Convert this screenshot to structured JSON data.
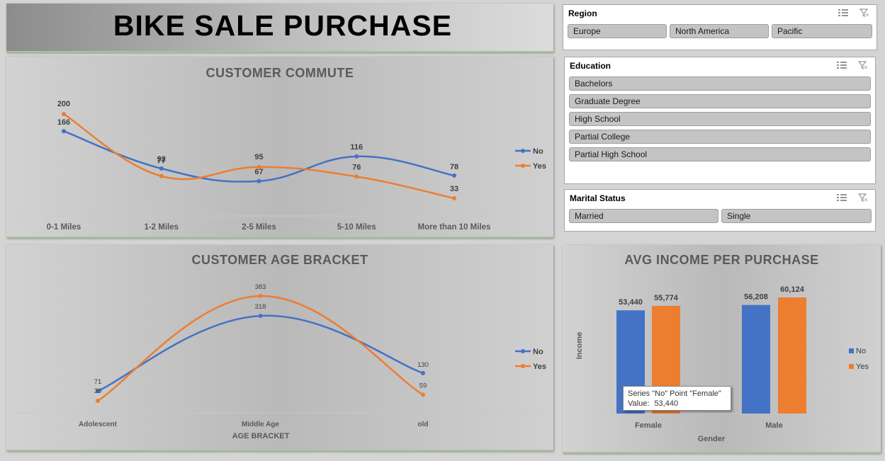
{
  "page_title": "BIKE SALE PURCHASE",
  "legend": {
    "no": "No",
    "yes": "Yes"
  },
  "colors": {
    "no": "#4472c4",
    "yes": "#ed7d31"
  },
  "slicers": {
    "region": {
      "title": "Region",
      "items": [
        "Europe",
        "North America",
        "Pacific"
      ]
    },
    "education": {
      "title": "Education",
      "items": [
        "Bachelors",
        "Graduate Degree",
        "High School",
        "Partial College",
        "Partial High School"
      ]
    },
    "marital": {
      "title": "Marital Status",
      "items": [
        "Married",
        "Single"
      ]
    }
  },
  "tooltip": {
    "line1": "Series \"No\" Point \"Female\"",
    "line2_label": "Value:",
    "line2_value": "53,440"
  },
  "chart_data": [
    {
      "type": "line",
      "title": "CUSTOMER COMMUTE",
      "categories": [
        "0-1 Miles",
        "1-2 Miles",
        "2-5 Miles",
        "5-10 Miles",
        "More than 10 Miles"
      ],
      "series": [
        {
          "name": "No",
          "values": [
            166,
            92,
            67,
            116,
            78
          ]
        },
        {
          "name": "Yes",
          "values": [
            200,
            77,
            95,
            76,
            33
          ]
        }
      ],
      "smooth": true,
      "legend_position": "right"
    },
    {
      "type": "line",
      "title": "CUSTOMER AGE BRACKET",
      "xlabel": "AGE BRACKET",
      "categories": [
        "Adolescent",
        "Middle Age",
        "old"
      ],
      "series": [
        {
          "name": "No",
          "values": [
            71,
            318,
            130
          ]
        },
        {
          "name": "Yes",
          "values": [
            39,
            383,
            59
          ]
        }
      ],
      "smooth": true,
      "legend_position": "right"
    },
    {
      "type": "bar",
      "title": "AVG INCOME PER PURCHASE",
      "xlabel": "Gender",
      "ylabel": "Income",
      "categories": [
        "Female",
        "Male"
      ],
      "series": [
        {
          "name": "No",
          "values": [
            53440,
            56208
          ],
          "labels": [
            "53,440",
            "56,208"
          ]
        },
        {
          "name": "Yes",
          "values": [
            55774,
            60124
          ],
          "labels": [
            "55,774",
            "60,124"
          ]
        }
      ],
      "legend_position": "right"
    }
  ]
}
